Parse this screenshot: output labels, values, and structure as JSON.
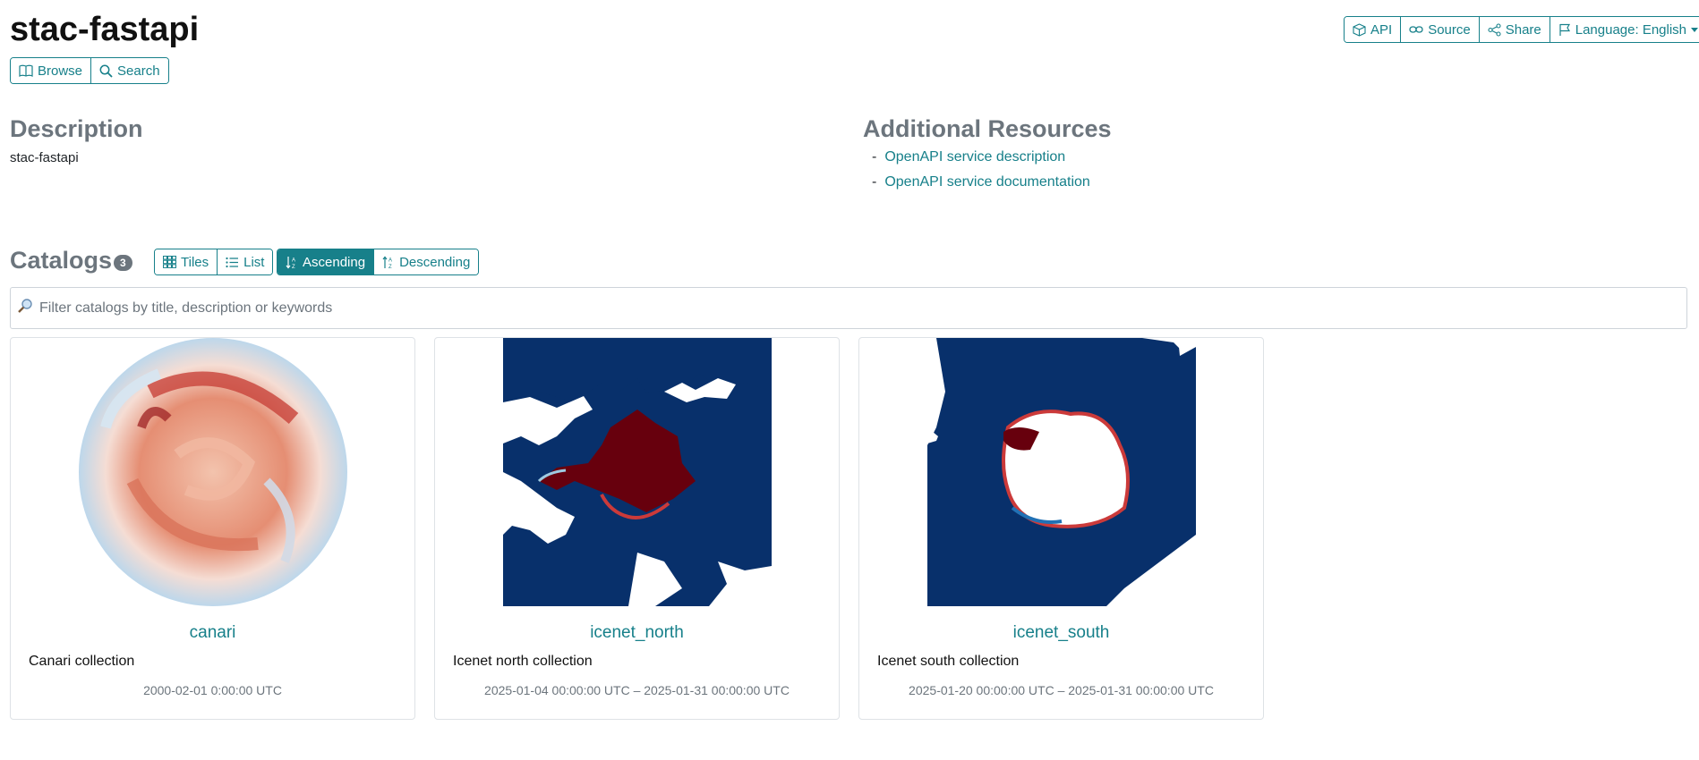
{
  "header": {
    "title": "stac-fastapi"
  },
  "nav": {
    "browse_label": "Browse",
    "search_label": "Search"
  },
  "toolbar": {
    "api_label": "API",
    "source_label": "Source",
    "share_label": "Share",
    "language_label": "Language: English"
  },
  "description": {
    "heading": "Description",
    "text": "stac-fastapi"
  },
  "resources": {
    "heading": "Additional Resources",
    "links": [
      "OpenAPI service description",
      "OpenAPI service documentation"
    ]
  },
  "catalogs": {
    "heading": "Catalogs",
    "count": "3",
    "view_tiles_label": "Tiles",
    "view_list_label": "List",
    "sort_asc_label": "Ascending",
    "sort_desc_label": "Descending",
    "filter_placeholder": "Filter catalogs by title, description or keywords",
    "items": [
      {
        "title": "canari",
        "description": "Canari collection",
        "dates": "2000-02-01 0:00:00 UTC"
      },
      {
        "title": "icenet_north",
        "description": "Icenet north collection",
        "dates": "2025-01-04 00:00:00 UTC – 2025-01-31 00:00:00 UTC"
      },
      {
        "title": "icenet_south",
        "description": "Icenet south collection",
        "dates": "2025-01-20 00:00:00 UTC – 2025-01-31 00:00:00 UTC"
      }
    ]
  },
  "colors": {
    "accent": "#17808a",
    "ocean": "#08306b",
    "ice_red": "#67000d",
    "muted": "#6c757d"
  },
  "icons": {
    "browse": "book-icon",
    "search": "search-icon",
    "api": "cube-icon",
    "source": "link-icon",
    "share": "share-icon",
    "language": "flag-icon",
    "tiles": "grid-icon",
    "list": "list-icon",
    "asc": "sort-asc-icon",
    "desc": "sort-desc-icon",
    "filter": "magnifier-icon"
  }
}
